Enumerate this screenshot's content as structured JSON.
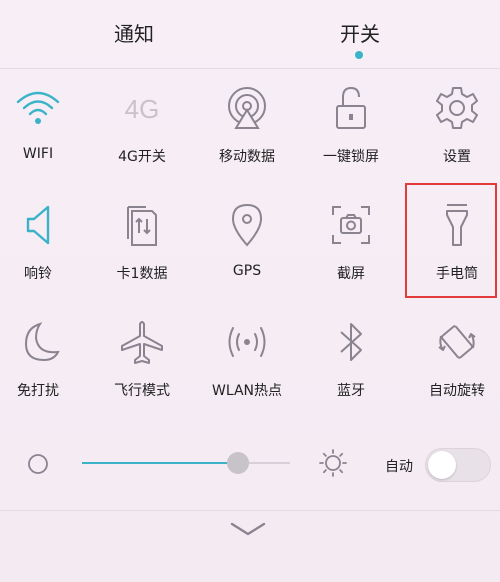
{
  "tabs": {
    "notify": "通知",
    "switches": "开关",
    "active": "switches"
  },
  "tiles": [
    {
      "label": "WIFI",
      "icon": "wifi-icon",
      "active": true
    },
    {
      "label": "4G开关",
      "icon": "4g-icon",
      "active": false,
      "icon_text": "4G"
    },
    {
      "label": "移动数据",
      "icon": "mobile-data-icon",
      "active": false
    },
    {
      "label": "一键锁屏",
      "icon": "lock-icon",
      "active": false
    },
    {
      "label": "设置",
      "icon": "gear-icon",
      "active": false
    },
    {
      "label": "响铃",
      "icon": "speaker-icon",
      "active": true
    },
    {
      "label": "卡1数据",
      "icon": "sim-data-icon",
      "active": false
    },
    {
      "label": "GPS",
      "icon": "location-pin-icon",
      "active": false
    },
    {
      "label": "截屏",
      "icon": "screenshot-icon",
      "active": false
    },
    {
      "label": "手电筒",
      "icon": "flashlight-icon",
      "active": false
    },
    {
      "label": "免打扰",
      "icon": "moon-icon",
      "active": false
    },
    {
      "label": "飞行模式",
      "icon": "airplane-icon",
      "active": false
    },
    {
      "label": "WLAN热点",
      "icon": "hotspot-icon",
      "active": false
    },
    {
      "label": "蓝牙",
      "icon": "bluetooth-icon",
      "active": false
    },
    {
      "label": "自动旋转",
      "icon": "rotate-icon",
      "active": false
    }
  ],
  "brightness": {
    "level": 0.75,
    "auto_label": "自动",
    "auto_on": false
  },
  "colors": {
    "accent": "#3ab3c9",
    "icon": "#8a8490",
    "highlight": "#e23b3b"
  }
}
